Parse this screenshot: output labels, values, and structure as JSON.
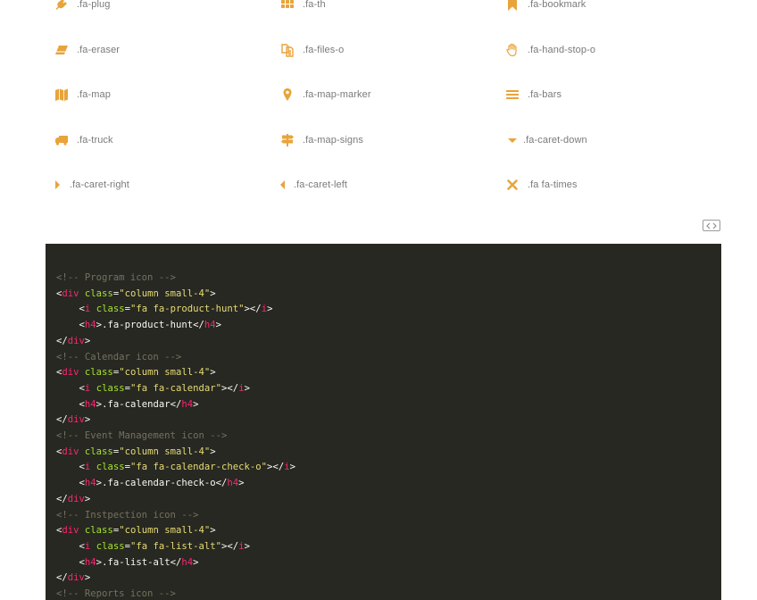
{
  "accent_color": "#e8a43a",
  "icons": [
    [
      {
        "icon": "plug-icon",
        "label": ".fa-plug"
      },
      {
        "icon": "th-icon",
        "label": ".fa-th"
      },
      {
        "icon": "bookmark-icon",
        "label": ".fa-bookmark"
      }
    ],
    [
      {
        "icon": "eraser-icon",
        "label": ".fa-eraser"
      },
      {
        "icon": "files-o-icon",
        "label": ".fa-files-o"
      },
      {
        "icon": "hand-stop-o-icon",
        "label": ".fa-hand-stop-o"
      }
    ],
    [
      {
        "icon": "map-icon",
        "label": ".fa-map"
      },
      {
        "icon": "map-marker-icon",
        "label": ".fa-map-marker"
      },
      {
        "icon": "bars-icon",
        "label": ".fa-bars"
      }
    ],
    [
      {
        "icon": "truck-icon",
        "label": ".fa-truck"
      },
      {
        "icon": "map-signs-icon",
        "label": ".fa-map-signs"
      },
      {
        "icon": "caret-down-icon",
        "label": ".fa-caret-down"
      }
    ],
    [
      {
        "icon": "caret-right-icon",
        "label": ".fa-caret-right"
      },
      {
        "icon": "caret-left-icon",
        "label": ".fa-caret-left"
      },
      {
        "icon": "times-icon",
        "label": ".fa fa-times"
      }
    ]
  ],
  "code_toggle": {
    "icon": "code-icon"
  },
  "code_lines": [
    "<!-- Program icon -->",
    "<div class=\"column small-4\">",
    "    <i class=\"fa fa-product-hunt\"></i>",
    "    <h4>.fa-product-hunt</h4>",
    "</div>",
    "<!-- Calendar icon -->",
    "<div class=\"column small-4\">",
    "    <i class=\"fa fa-calendar\"></i>",
    "    <h4>.fa-calendar</h4>",
    "</div>",
    "<!-- Event Management icon -->",
    "<div class=\"column small-4\">",
    "    <i class=\"fa fa-calendar-check-o\"></i>",
    "    <h4>.fa-calendar-check-o</h4>",
    "</div>",
    "<!-- Instpection icon -->",
    "<div class=\"column small-4\">",
    "    <i class=\"fa fa-list-alt\"></i>",
    "    <h4>.fa-list-alt</h4>",
    "</div>",
    "<!-- Reports icon -->"
  ]
}
